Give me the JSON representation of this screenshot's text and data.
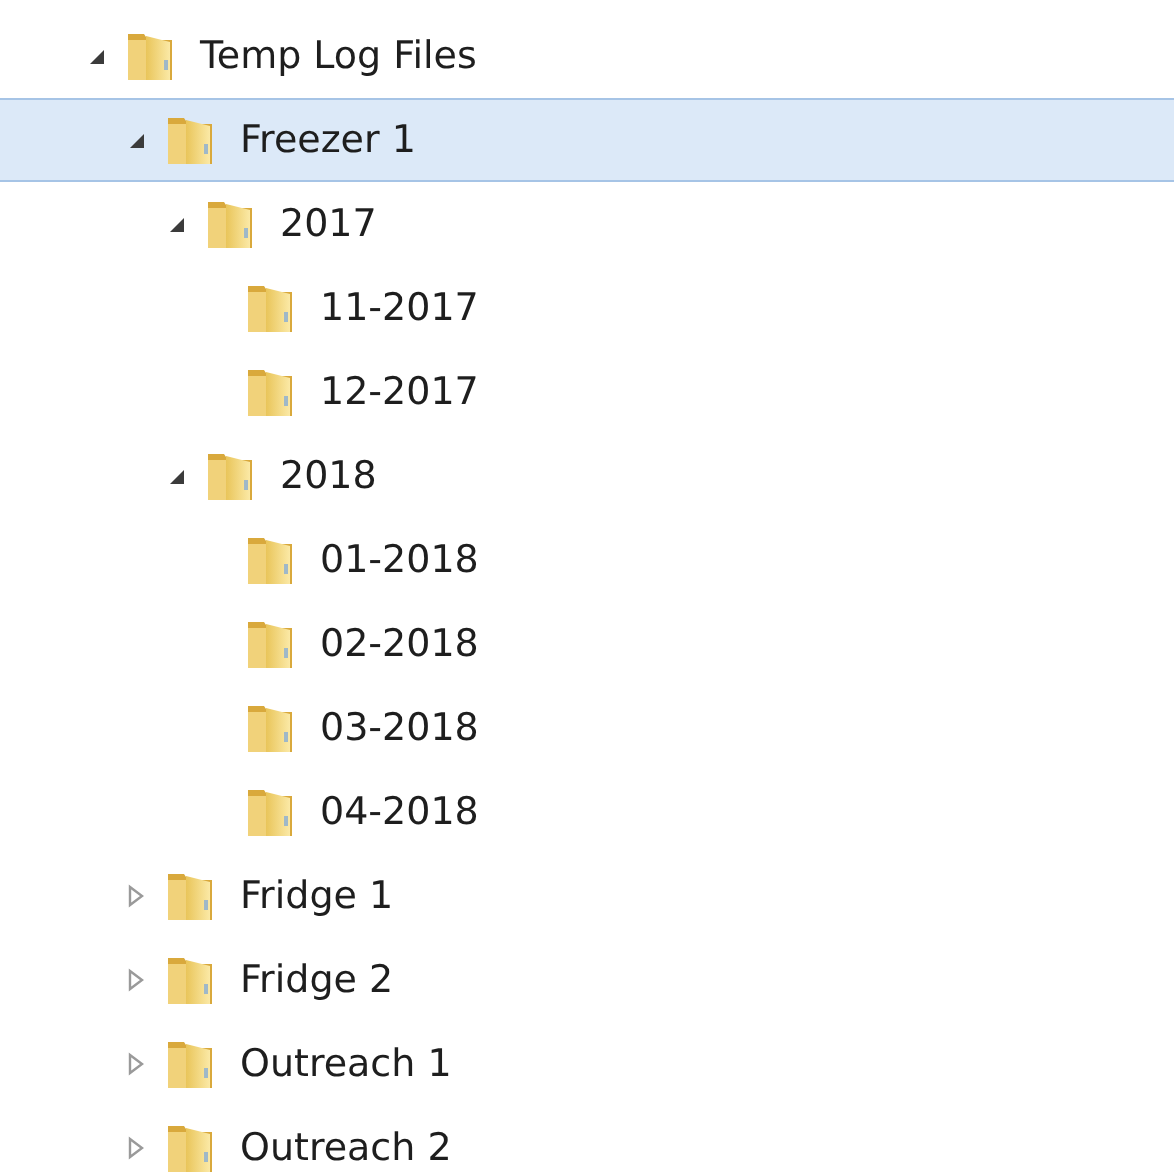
{
  "tree": [
    {
      "label": "Temp Log Files",
      "expanded": true,
      "selected": false,
      "children": [
        {
          "label": "Freezer 1",
          "expanded": true,
          "selected": true,
          "children": [
            {
              "label": "2017",
              "expanded": true,
              "selected": false,
              "children": [
                {
                  "label": "11-2017",
                  "selected": false
                },
                {
                  "label": "12-2017",
                  "selected": false
                }
              ]
            },
            {
              "label": "2018",
              "expanded": true,
              "selected": false,
              "children": [
                {
                  "label": "01-2018",
                  "selected": false
                },
                {
                  "label": "02-2018",
                  "selected": false
                },
                {
                  "label": "03-2018",
                  "selected": false
                },
                {
                  "label": "04-2018",
                  "selected": false
                }
              ]
            }
          ]
        },
        {
          "label": "Fridge 1",
          "expanded": false,
          "selected": false
        },
        {
          "label": "Fridge 2",
          "expanded": false,
          "selected": false
        },
        {
          "label": "Outreach 1",
          "expanded": false,
          "selected": false
        },
        {
          "label": "Outreach 2",
          "expanded": false,
          "selected": false
        }
      ]
    }
  ]
}
